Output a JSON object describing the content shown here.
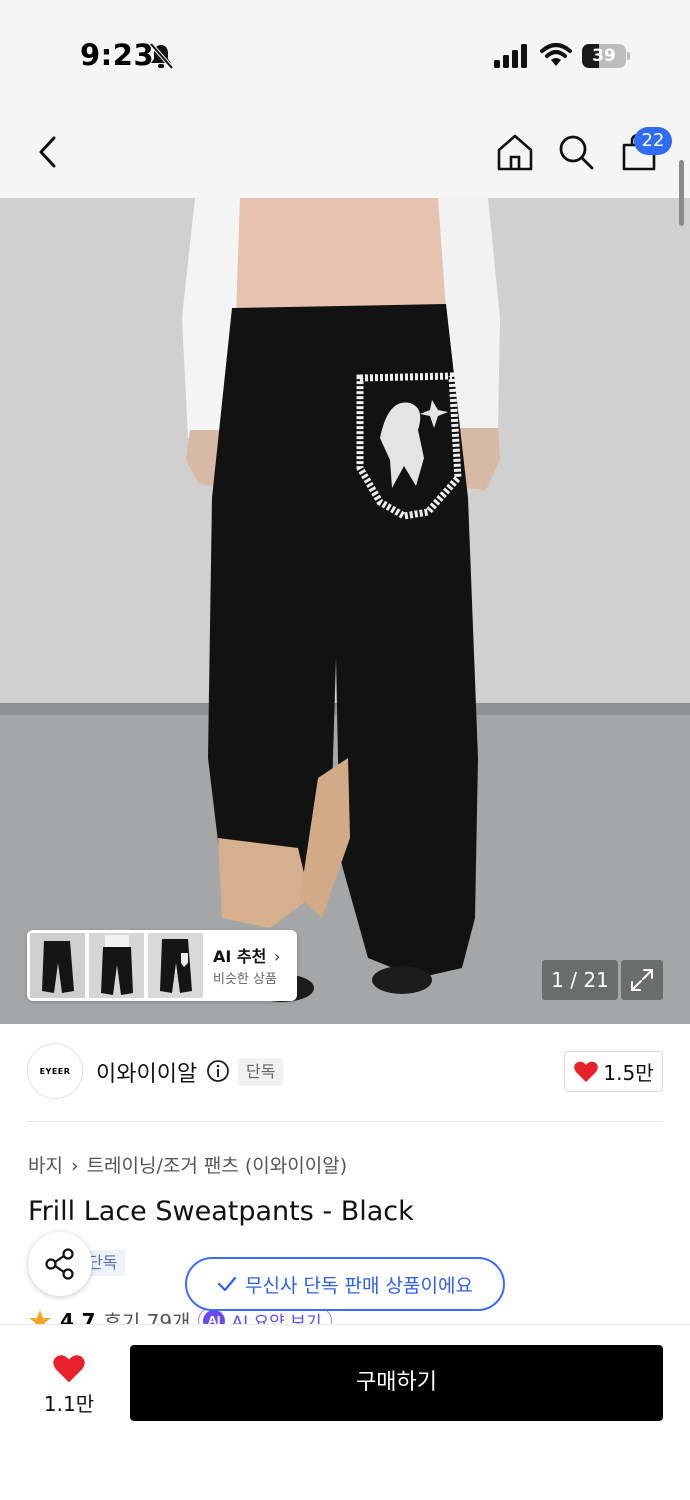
{
  "status_bar": {
    "time": "9:23",
    "battery_level": "39",
    "battery_fraction": 0.39,
    "icons": [
      "bell-muted-icon",
      "cellular-signal-icon",
      "wifi-icon",
      "battery-icon"
    ]
  },
  "nav": {
    "icons": [
      "back-icon",
      "home-icon",
      "search-icon",
      "cart-icon"
    ],
    "cart_count": "22"
  },
  "hero": {
    "ai_recommend": {
      "title": "AI 추천",
      "subtitle": "비슷한 상품"
    },
    "page_counter": "1 / 21"
  },
  "brand": {
    "logo_text": "EYEER",
    "name": "이와이이알",
    "exclusive_tag": "단독",
    "like_count": "1.5만"
  },
  "product": {
    "breadcrumb": [
      "바지",
      "트레이닝/조거 팬츠 (이와이이알)"
    ],
    "title": "Frill Lace Sweatpants - Black",
    "exclusive_tag_partial": "단독",
    "rating": "4.7",
    "reviews": "후기 79개",
    "ai_summary": "AI 요약 보기",
    "ai_badge": "AI"
  },
  "toast": {
    "text": "무신사 단독 판매 상품이에요"
  },
  "bottom_bar": {
    "wish_count": "1.1만",
    "buy_label": "구매하기"
  },
  "colors": {
    "accent_blue": "#2f6df6",
    "heart_red": "#e8202b",
    "ai_purple": "#6a4bf0"
  }
}
